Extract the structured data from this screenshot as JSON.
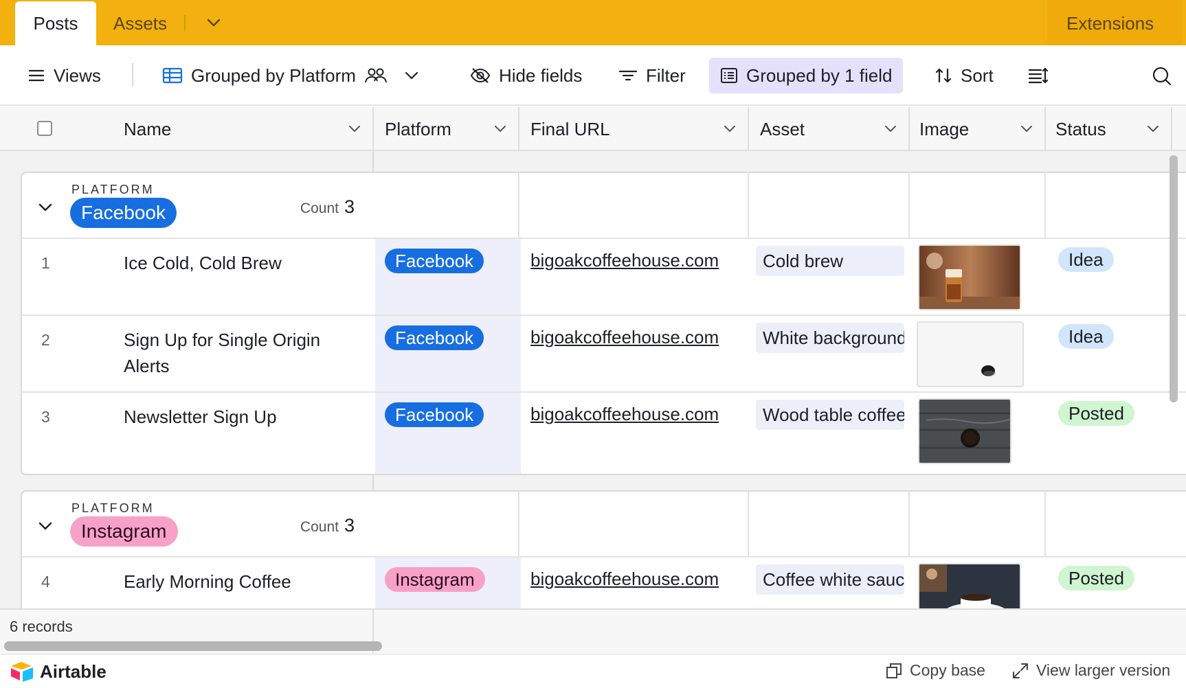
{
  "tabs": {
    "active": "Posts",
    "other": "Assets",
    "extensions": "Extensions"
  },
  "toolbar": {
    "views": "Views",
    "view_name": "Grouped by Platform",
    "hide_fields": "Hide fields",
    "filter": "Filter",
    "grouped": "Grouped by 1 field",
    "sort": "Sort"
  },
  "columns": [
    "Name",
    "Platform",
    "Final URL",
    "Asset",
    "Image",
    "Status"
  ],
  "groups": [
    {
      "label": "PLATFORM",
      "value": "Facebook",
      "count_label": "Count",
      "count": "3",
      "rows": [
        {
          "num": "1",
          "name": "Ice Cold, Cold Brew",
          "platform": "Facebook",
          "url": "bigoakcoffeehouse.com",
          "asset": "Cold brew",
          "status": "Idea"
        },
        {
          "num": "2",
          "name": "Sign Up for Single Origin Alerts",
          "platform": "Facebook",
          "url": "bigoakcoffeehouse.com",
          "asset": "White background",
          "status": "Idea"
        },
        {
          "num": "3",
          "name": "Newsletter Sign Up",
          "platform": "Facebook",
          "url": "bigoakcoffeehouse.com",
          "asset": "Wood table coffee",
          "status": "Posted"
        }
      ]
    },
    {
      "label": "PLATFORM",
      "value": "Instagram",
      "count_label": "Count",
      "count": "3",
      "rows": [
        {
          "num": "4",
          "name": "Early Morning Coffee",
          "platform": "Instagram",
          "url": "bigoakcoffeehouse.com",
          "asset": "Coffee white saucer",
          "status": "Posted"
        }
      ]
    }
  ],
  "footer": {
    "records": "6 records"
  },
  "bottom": {
    "brand": "Airtable",
    "copy_base": "Copy base",
    "view_larger": "View larger version"
  },
  "colors": {
    "tabbar": "#f2b10f",
    "facebook": "#166ee1",
    "instagram": "#f7a1c8",
    "idea": "#d1e6fb",
    "posted": "#cff5d1"
  }
}
